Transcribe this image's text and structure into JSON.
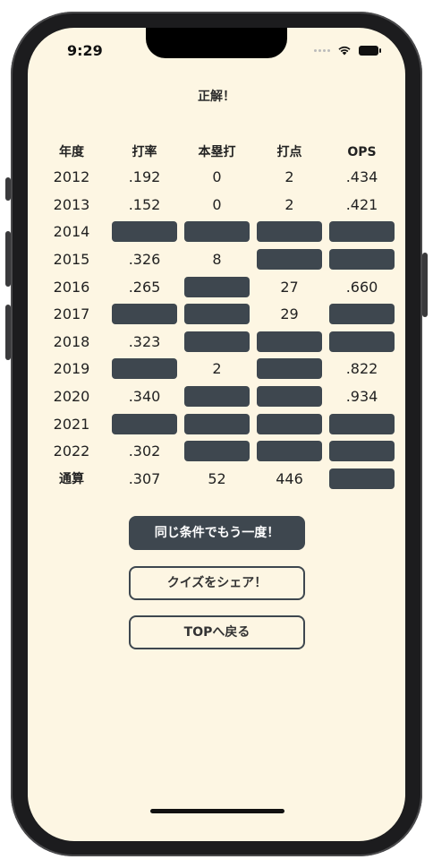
{
  "status_bar": {
    "time": "9:29"
  },
  "title": "正解！",
  "table": {
    "headers": [
      "年度",
      "打率",
      "本塁打",
      "打点",
      "OPS"
    ],
    "rows": [
      {
        "year": "2012",
        "avg": ".192",
        "hr": "0",
        "rbi": "2",
        "ops": ".434"
      },
      {
        "year": "2013",
        "avg": ".152",
        "hr": "0",
        "rbi": "2",
        "ops": ".421"
      },
      {
        "year": "2014",
        "avg": null,
        "hr": null,
        "rbi": null,
        "ops": null
      },
      {
        "year": "2015",
        "avg": ".326",
        "hr": "8",
        "rbi": null,
        "ops": null
      },
      {
        "year": "2016",
        "avg": ".265",
        "hr": null,
        "rbi": "27",
        "ops": ".660"
      },
      {
        "year": "2017",
        "avg": null,
        "hr": null,
        "rbi": "29",
        "ops": null
      },
      {
        "year": "2018",
        "avg": ".323",
        "hr": null,
        "rbi": null,
        "ops": null
      },
      {
        "year": "2019",
        "avg": null,
        "hr": "2",
        "rbi": null,
        "ops": ".822"
      },
      {
        "year": "2020",
        "avg": ".340",
        "hr": null,
        "rbi": null,
        "ops": ".934"
      },
      {
        "year": "2021",
        "avg": null,
        "hr": null,
        "rbi": null,
        "ops": null
      },
      {
        "year": "2022",
        "avg": ".302",
        "hr": null,
        "rbi": null,
        "ops": null
      },
      {
        "year": "通算",
        "avg": ".307",
        "hr": "52",
        "rbi": "446",
        "ops": null
      }
    ]
  },
  "buttons": {
    "retry": "同じ条件でもう一度！",
    "share": "クイズをシェア！",
    "top": "TOPへ戻る"
  },
  "colors": {
    "background": "#fdf6e3",
    "hidden_cell": "#3e474f",
    "text": "#222222"
  }
}
